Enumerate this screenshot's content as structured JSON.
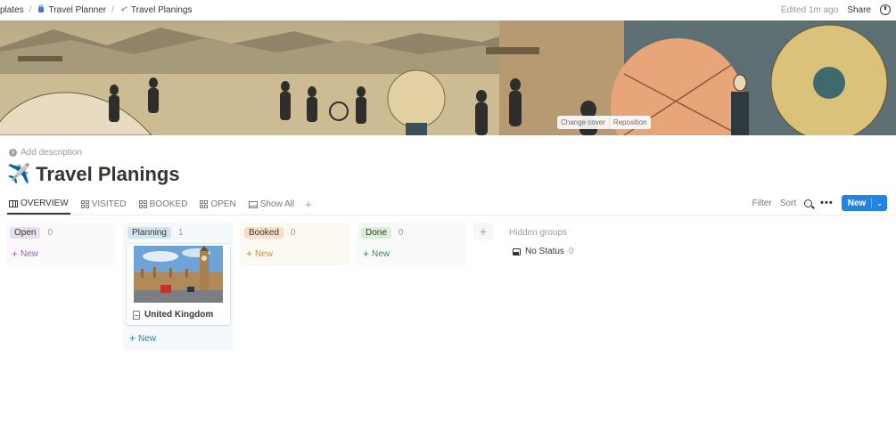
{
  "breadcrumbs": [
    {
      "label": "plates",
      "icon": ""
    },
    {
      "label": "Travel Planner",
      "icon": "suitcase-icon"
    },
    {
      "label": "Travel Planings",
      "icon": "airplane-icon"
    }
  ],
  "topbar": {
    "edited": "Edited 1m ago",
    "share": "Share",
    "history_icon": "clock-icon"
  },
  "cover": {
    "change_cover": "Change cover",
    "reposition": "Reposition"
  },
  "page": {
    "add_description": "Add description",
    "title": "Travel Planings",
    "title_icon": "✈️"
  },
  "tabs": [
    {
      "label": "OVERVIEW",
      "icon": "board-icon",
      "active": true
    },
    {
      "label": "VISITED",
      "icon": "gallery-icon",
      "active": false
    },
    {
      "label": "BOOKED",
      "icon": "gallery-icon",
      "active": false
    },
    {
      "label": "OPEN",
      "icon": "gallery-icon",
      "active": false
    },
    {
      "label": "Show All",
      "icon": "table-icon",
      "active": false
    }
  ],
  "toolbar": {
    "filter": "Filter",
    "sort": "Sort",
    "more": "•••",
    "new": "New"
  },
  "board": {
    "columns": [
      {
        "label": "Open",
        "count": "0",
        "new": "New",
        "pill_color": "#e8deee",
        "bg": "#fbf9fc",
        "text_color": "#9065b0"
      },
      {
        "label": "Planning",
        "count": "1",
        "new": "New",
        "pill_color": "#d3e5ef",
        "bg": "#f4f9fc",
        "text_color": "#337ea9",
        "cards": [
          {
            "title": "United Kingdom"
          }
        ]
      },
      {
        "label": "Booked",
        "count": "0",
        "new": "New",
        "pill_color": "#fadec9",
        "bg": "#fcf9f3",
        "text_color": "#cb912f"
      },
      {
        "label": "Done",
        "count": "0",
        "new": "New",
        "pill_color": "#dbeddb",
        "bg": "#f7faf7",
        "text_color": "#448361"
      }
    ],
    "hidden_groups": "Hidden groups",
    "no_status": {
      "label": "No Status",
      "count": "0"
    }
  },
  "accent": "#2383e2"
}
